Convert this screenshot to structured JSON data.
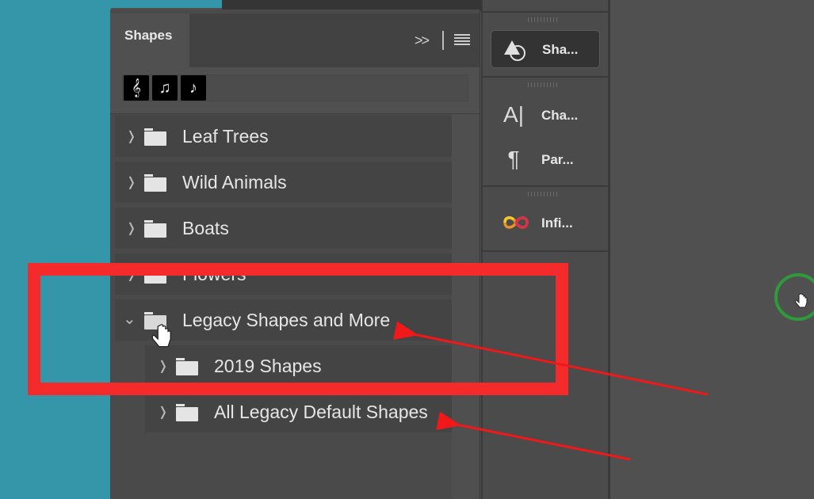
{
  "panel": {
    "tab_label": "Shapes",
    "collapse_icon": "double-chevron-right-icon",
    "menu_icon": "hamburger-menu-icon",
    "recent_shapes": [
      "𝄞",
      "♫",
      "♪"
    ]
  },
  "shape_groups": [
    {
      "label": "Leaf Trees",
      "expanded": false,
      "level": 0
    },
    {
      "label": "Wild Animals",
      "expanded": false,
      "level": 0
    },
    {
      "label": "Boats",
      "expanded": false,
      "level": 0
    },
    {
      "label": "Flowers",
      "expanded": false,
      "level": 0
    },
    {
      "label": "Legacy Shapes and More",
      "expanded": true,
      "level": 0
    },
    {
      "label": "2019 Shapes",
      "expanded": false,
      "level": 1
    },
    {
      "label": "All Legacy Default Shapes",
      "expanded": false,
      "level": 1
    }
  ],
  "dock": {
    "items": [
      {
        "label": "Sha...",
        "icon": "shapes-icon",
        "active": true
      },
      {
        "label": "Cha...",
        "icon": "character-icon",
        "active": false
      },
      {
        "label": "Par...",
        "icon": "paragraph-icon",
        "active": false
      },
      {
        "label": "Infi...",
        "icon": "infinite-color-icon",
        "active": false
      }
    ]
  },
  "annotations": {
    "highlight_color": "#f52a2a",
    "cursor_ring_color": "#2e9a3a"
  }
}
